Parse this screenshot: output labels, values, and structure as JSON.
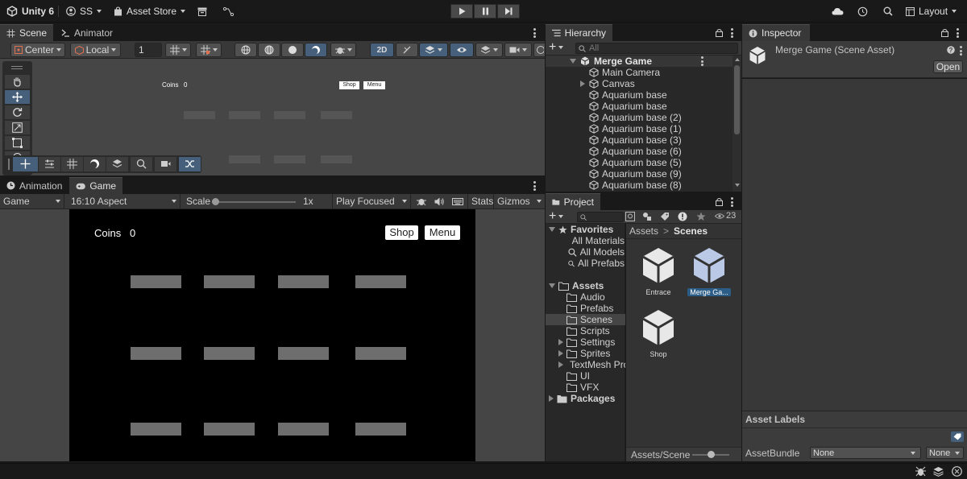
{
  "topbar": {
    "app_name": "Unity 6",
    "account": "SS",
    "asset_store": "Asset Store",
    "layout": "Layout"
  },
  "scene_panel": {
    "tab_scene": "Scene",
    "tab_animator": "Animator",
    "pivot": "Center",
    "space": "Local",
    "snap_value": "1",
    "mode_2d": "2D",
    "preview": {
      "coins_label": "Coins",
      "coins_value": "0",
      "shop": "Shop",
      "menu": "Menu"
    }
  },
  "game_panel": {
    "tab_animation": "Animation",
    "tab_game": "Game",
    "display": "Game",
    "aspect": "16:10 Aspect",
    "scale_label": "Scale",
    "scale_value": "1x",
    "play_mode": "Play Focused",
    "stats": "Stats",
    "gizmos": "Gizmos",
    "view": {
      "coins_label": "Coins",
      "coins_value": "0",
      "shop": "Shop",
      "menu": "Menu"
    }
  },
  "hierarchy": {
    "title": "Hierarchy",
    "search_placeholder": "All",
    "scene_name": "Merge Game",
    "items": [
      "Main Camera",
      "Canvas",
      "Aquarium base",
      "Aquarium base",
      "Aquarium base (2)",
      "Aquarium base (1)",
      "Aquarium base (3)",
      "Aquarium base (6)",
      "Aquarium base (5)",
      "Aquarium base (9)",
      "Aquarium base (8)"
    ]
  },
  "project": {
    "title": "Project",
    "count": "23",
    "favorites": "Favorites",
    "fav_items": [
      "All Materials",
      "All Models",
      "All Prefabs"
    ],
    "assets": "Assets",
    "asset_folders": [
      "Audio",
      "Prefabs",
      "Scenes",
      "Scripts",
      "Settings",
      "Sprites",
      "TextMesh Pro",
      "UI",
      "VFX"
    ],
    "packages": "Packages",
    "breadcrumb_root": "Assets",
    "breadcrumb_current": "Scenes",
    "files": [
      "Entrace",
      "Merge Ga...",
      "Shop"
    ],
    "footer_path": "Assets/Scenes"
  },
  "inspector": {
    "title": "Inspector",
    "object_name": "Merge Game (Scene Asset)",
    "open_button": "Open",
    "asset_labels": "Asset Labels",
    "asset_bundle_label": "AssetBundle",
    "asset_bundle_value": "None",
    "variant_value": "None"
  },
  "colors": {
    "accent_blue": "#46607c",
    "panel_bg": "#383838",
    "dark_bg": "#191919",
    "selection": "#2c5d87"
  }
}
